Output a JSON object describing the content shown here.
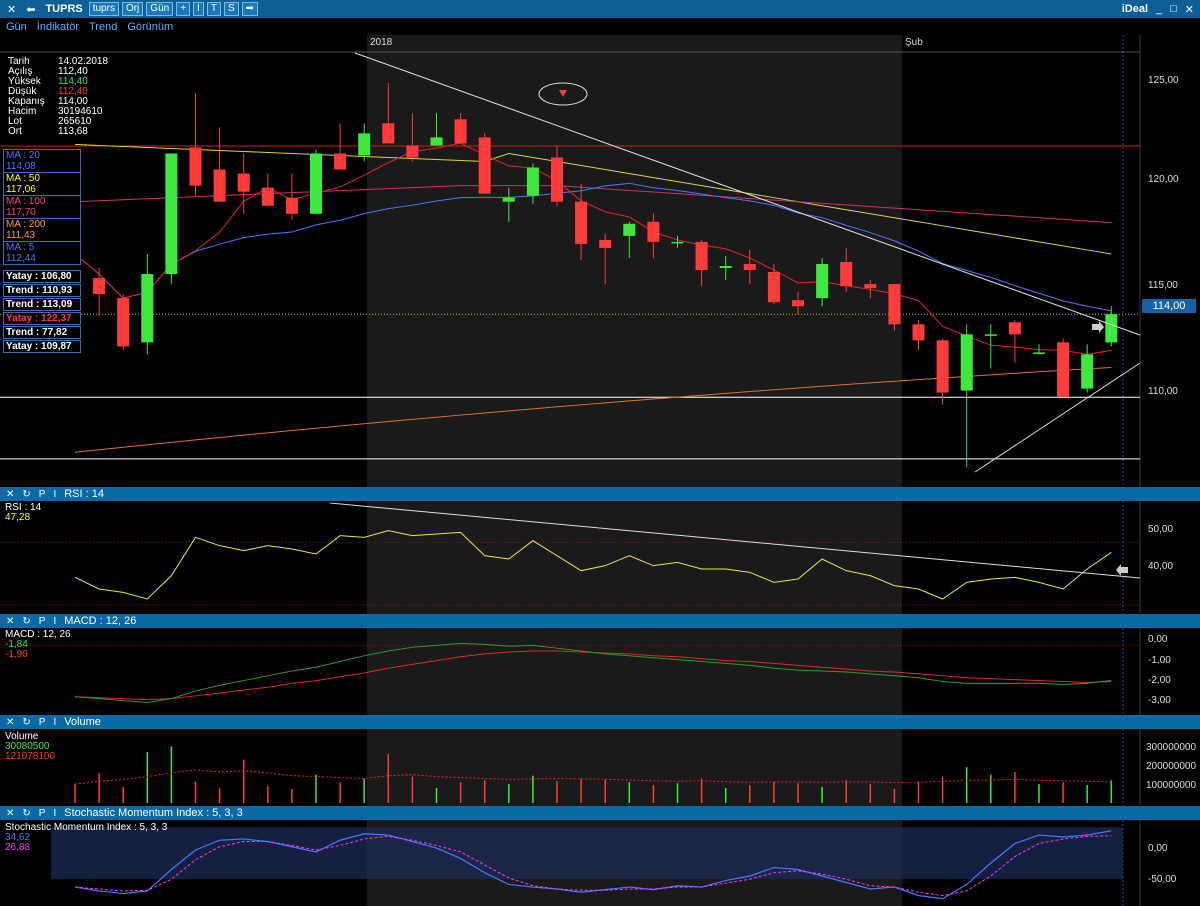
{
  "titlebar": {
    "symbol": "TUPRS",
    "tab1": "tuprs",
    "tab2": "Orj",
    "tab3": "Gün",
    "buttons": [
      "+",
      "I",
      "T",
      "S",
      "➡"
    ],
    "app_name": "iDeal",
    "window_controls": [
      "_",
      "□",
      "✕"
    ]
  },
  "menu": [
    "Gün",
    "İndikatör",
    "Trend",
    "Görünüm"
  ],
  "date_axis": {
    "label1": "2018",
    "label2": "Şub"
  },
  "info_panel": {
    "rows": [
      {
        "k": "Tarih",
        "v": "14.02.2018",
        "color": "#ffffff"
      },
      {
        "k": "Açılış",
        "v": "112,40",
        "color": "#ffffff"
      },
      {
        "k": "Yüksek",
        "v": "114,40",
        "color": "#3fe83f"
      },
      {
        "k": "Düşük",
        "v": "112,40",
        "color": "#ff3b3b"
      },
      {
        "k": "Kapanış",
        "v": "114,00",
        "color": "#ffffff"
      },
      {
        "k": "Hacim",
        "v": "30194610",
        "color": "#ffffff"
      },
      {
        "k": "Lot",
        "v": "265610",
        "color": "#ffffff"
      },
      {
        "k": "Ort",
        "v": "113,68",
        "color": "#ffffff"
      }
    ]
  },
  "ma_labels": [
    {
      "name": "MA : 20",
      "value": "114,08",
      "color": "#4a78ff"
    },
    {
      "name": "MA : 50",
      "value": "117,06",
      "color": "#ffff33"
    },
    {
      "name": "MA : 100",
      "value": "117,70",
      "color": "#ff3b8a"
    },
    {
      "name": "MA : 200",
      "value": "111,43",
      "color": "#ff9933"
    },
    {
      "name": "MA : 5",
      "value": "112,44",
      "color": "#4a78ff"
    }
  ],
  "trend_labels": [
    {
      "text": "Yatay  :  106,80",
      "color": "#ffffff"
    },
    {
      "text": "Trend  :  110,93",
      "color": "#ffffff"
    },
    {
      "text": "Trend  :  113,09",
      "color": "#ffffff"
    },
    {
      "text": "Yatay  :  122,37",
      "color": "#ff3b3b"
    },
    {
      "text": "Trend  :  77,82",
      "color": "#ffffff"
    },
    {
      "text": "Yatay  :  109,87",
      "color": "#ffffff"
    }
  ],
  "price_axis": {
    "ticks": [
      "125,00",
      "120,00",
      "115,00",
      "110,00"
    ],
    "current": "114,00"
  },
  "rsi": {
    "header": "RSI : 14",
    "label": "RSI : 14",
    "value": "47,28",
    "ticks": [
      "50,00",
      "40,00"
    ]
  },
  "macd": {
    "header": "MACD : 12, 26",
    "label": "MACD : 12, 26",
    "value1": "-1,84",
    "value2": "-1,90",
    "ticks": [
      "0,00",
      "-1,00",
      "-2,00",
      "-3,00"
    ]
  },
  "volume": {
    "header": "Volume",
    "label": "Volume",
    "value1": "30080500",
    "value2": "121078100",
    "ticks": [
      "300000000",
      "200000000",
      "100000000"
    ]
  },
  "smi": {
    "header": "Stochastic Momentum Index : 5, 3, 3",
    "label": "Stochastic Momentum Index : 5, 3, 3",
    "value1": "34,62",
    "value2": "26,88",
    "ticks": [
      "0,00",
      "-50,00"
    ]
  },
  "pane_icons": [
    "✕",
    "↻",
    "P",
    "I"
  ],
  "colors": {
    "up": "#3fe83f",
    "down": "#ff3b3b",
    "header": "#0a6aa6",
    "shade": "#1a1a1a"
  },
  "chart_data": {
    "type": "candlestick",
    "candles": [
      [
        119.9,
        120.0,
        116.5,
        117.0
      ],
      [
        115.8,
        116.3,
        113.9,
        115.0
      ],
      [
        114.8,
        115.0,
        112.2,
        112.4
      ],
      [
        112.6,
        117.0,
        112.0,
        116.0
      ],
      [
        116.0,
        122.0,
        115.5,
        122.0
      ],
      [
        122.3,
        125.0,
        119.9,
        120.4
      ],
      [
        121.2,
        123.3,
        120.0,
        119.6
      ],
      [
        121.0,
        122.0,
        119.0,
        120.1
      ],
      [
        120.3,
        121.0,
        119.5,
        119.4
      ],
      [
        119.8,
        121.0,
        118.7,
        119.0
      ],
      [
        119.0,
        122.2,
        119.0,
        122.0
      ],
      [
        122.0,
        123.5,
        121.3,
        121.2
      ],
      [
        121.9,
        123.5,
        121.6,
        123.0
      ],
      [
        123.5,
        125.5,
        122.6,
        122.5
      ],
      [
        122.4,
        124.0,
        121.6,
        121.8
      ],
      [
        122.4,
        124.0,
        122.6,
        122.8
      ],
      [
        123.7,
        124.0,
        122.5,
        122.5
      ],
      [
        122.8,
        123.0,
        120.0,
        120.0
      ],
      [
        119.6,
        120.3,
        118.6,
        119.8
      ],
      [
        119.9,
        121.5,
        119.5,
        121.3
      ],
      [
        121.8,
        122.4,
        119.4,
        119.6
      ],
      [
        119.6,
        120.5,
        116.7,
        117.5
      ],
      [
        117.7,
        118.0,
        115.5,
        117.3
      ],
      [
        117.9,
        118.6,
        116.8,
        118.5
      ],
      [
        118.6,
        119.0,
        116.8,
        117.6
      ],
      [
        117.6,
        117.9,
        117.3,
        117.6
      ],
      [
        117.6,
        117.7,
        115.4,
        116.2
      ],
      [
        116.3,
        116.9,
        115.7,
        116.4
      ],
      [
        116.5,
        117.2,
        115.5,
        116.2
      ],
      [
        116.1,
        116.5,
        114.5,
        114.6
      ],
      [
        114.7,
        115.1,
        114.0,
        114.4
      ],
      [
        114.8,
        116.8,
        114.4,
        116.5
      ],
      [
        116.6,
        117.3,
        115.1,
        115.4
      ],
      [
        115.5,
        115.7,
        114.8,
        115.3
      ],
      [
        115.5,
        115.5,
        113.2,
        113.5
      ],
      [
        113.5,
        113.7,
        112.2,
        112.7
      ],
      [
        112.7,
        112.8,
        109.5,
        110.1
      ],
      [
        110.2,
        113.5,
        106.4,
        113.0
      ],
      [
        113.0,
        113.5,
        111.3,
        113.0
      ],
      [
        113.6,
        113.7,
        111.6,
        113.0
      ],
      [
        112.1,
        112.5,
        112.0,
        112.1
      ],
      [
        112.6,
        112.8,
        109.9,
        109.9
      ],
      [
        110.3,
        112.5,
        110.1,
        112.0
      ],
      [
        112.6,
        114.4,
        112.4,
        114.0
      ]
    ],
    "price_range": [
      106.0,
      127.0
    ],
    "rsi_values": [
      39.5,
      36.0,
      35.0,
      33.0,
      40.0,
      51.5,
      49.0,
      47.5,
      49.0,
      48.0,
      46.5,
      52.0,
      51.5,
      53.5,
      52.0,
      52.5,
      53.0,
      46.0,
      45.0,
      50.5,
      46.0,
      41.5,
      43.0,
      46.0,
      43.0,
      44.0,
      42.0,
      42.0,
      41.0,
      38.0,
      39.0,
      45.0,
      41.5,
      40.0,
      37.0,
      36.0,
      33.0,
      38.0,
      39.0,
      39.5,
      38.0,
      36.0,
      42.0,
      47.0
    ],
    "rsi_range": [
      30,
      60
    ],
    "macd_line": [
      -2.7,
      -2.8,
      -2.9,
      -3.0,
      -2.8,
      -2.4,
      -2.1,
      -1.85,
      -1.6,
      -1.35,
      -1.15,
      -0.85,
      -0.55,
      -0.3,
      -0.1,
      0.0,
      0.1,
      0.05,
      -0.05,
      0.0,
      -0.15,
      -0.3,
      -0.45,
      -0.55,
      -0.65,
      -0.75,
      -0.85,
      -0.95,
      -1.05,
      -1.2,
      -1.3,
      -1.35,
      -1.4,
      -1.5,
      -1.6,
      -1.7,
      -1.9,
      -2.0,
      -2.0,
      -2.0,
      -2.0,
      -2.05,
      -2.0,
      -1.84
    ],
    "macd_signal": [
      -2.7,
      -2.75,
      -2.8,
      -2.85,
      -2.8,
      -2.65,
      -2.5,
      -2.35,
      -2.2,
      -2.0,
      -1.85,
      -1.65,
      -1.45,
      -1.2,
      -1.0,
      -0.8,
      -0.6,
      -0.45,
      -0.35,
      -0.3,
      -0.3,
      -0.35,
      -0.4,
      -0.45,
      -0.55,
      -0.6,
      -0.7,
      -0.8,
      -0.85,
      -0.95,
      -1.05,
      -1.15,
      -1.25,
      -1.35,
      -1.4,
      -1.5,
      -1.6,
      -1.7,
      -1.75,
      -1.8,
      -1.85,
      -1.9,
      -1.95,
      -1.9
    ],
    "macd_range": [
      -3.5,
      0.7
    ],
    "volume_values": [
      100,
      160,
      85,
      270,
      300,
      115,
      80,
      230,
      90,
      75,
      150,
      110,
      130,
      260,
      140,
      80,
      110,
      120,
      100,
      145,
      115,
      130,
      125,
      110,
      95,
      105,
      130,
      80,
      95,
      115,
      105,
      85,
      120,
      100,
      75,
      115,
      140,
      190,
      150,
      165,
      100,
      110,
      95,
      120
    ],
    "volume_ma": [
      100,
      115,
      125,
      140,
      160,
      175,
      165,
      170,
      160,
      145,
      140,
      135,
      130,
      145,
      150,
      140,
      135,
      130,
      125,
      128,
      130,
      128,
      126,
      122,
      118,
      115,
      118,
      113,
      110,
      112,
      112,
      110,
      112,
      112,
      108,
      110,
      115,
      120,
      122,
      125,
      120,
      118,
      115,
      112
    ],
    "volume_range": [
      0,
      350
    ],
    "smi_values": [
      -52,
      -58,
      -62,
      -58,
      -25,
      5,
      20,
      22,
      18,
      10,
      2,
      20,
      30,
      28,
      18,
      8,
      -8,
      -30,
      -48,
      -52,
      -55,
      -60,
      -56,
      -52,
      -56,
      -50,
      -52,
      -42,
      -35,
      -22,
      -25,
      -35,
      -45,
      -55,
      -52,
      -65,
      -70,
      -48,
      -15,
      15,
      28,
      25,
      28,
      34.62
    ],
    "smi_signal": [
      -52,
      -55,
      -58,
      -57,
      -40,
      -10,
      10,
      18,
      18,
      12,
      5,
      12,
      22,
      26,
      20,
      12,
      2,
      -18,
      -38,
      -50,
      -55,
      -57,
      -57,
      -55,
      -55,
      -52,
      -52,
      -46,
      -40,
      -30,
      -27,
      -32,
      -40,
      -50,
      -52,
      -60,
      -65,
      -58,
      -35,
      -5,
      15,
      22,
      26,
      26.88
    ],
    "smi_range": [
      -75,
      45
    ]
  }
}
